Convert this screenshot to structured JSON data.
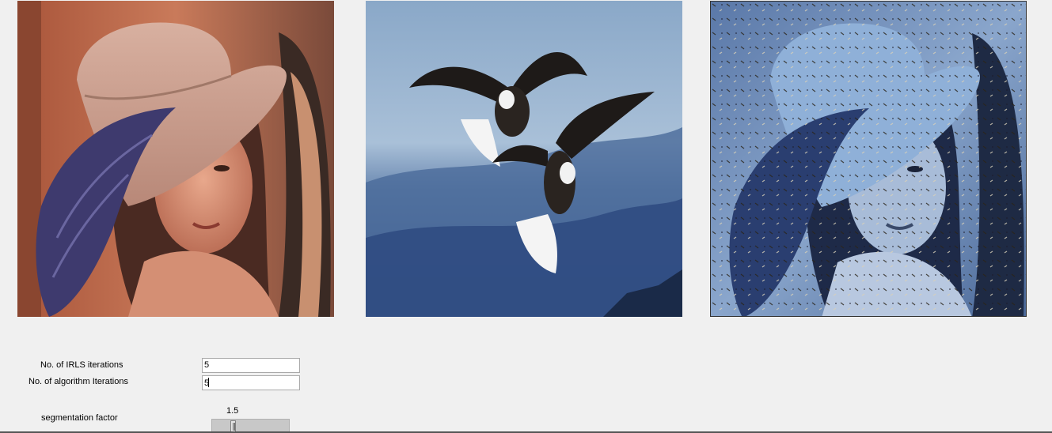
{
  "images": {
    "content": {
      "description_icon": "portrait-photo"
    },
    "style": {
      "description_icon": "eagles-photo"
    },
    "result": {
      "description_icon": "stylized-portrait-photo"
    }
  },
  "controls": {
    "irls_label": "No. of IRLS iterations",
    "irls_value": "5",
    "algo_label": "No. of algorithm Iterations",
    "algo_value": "5",
    "segmentation_label": "segmentation factor",
    "segmentation_value": "1.5",
    "segmentation_fraction": 0.25
  },
  "colors": {
    "background": "#f0f0f0"
  }
}
